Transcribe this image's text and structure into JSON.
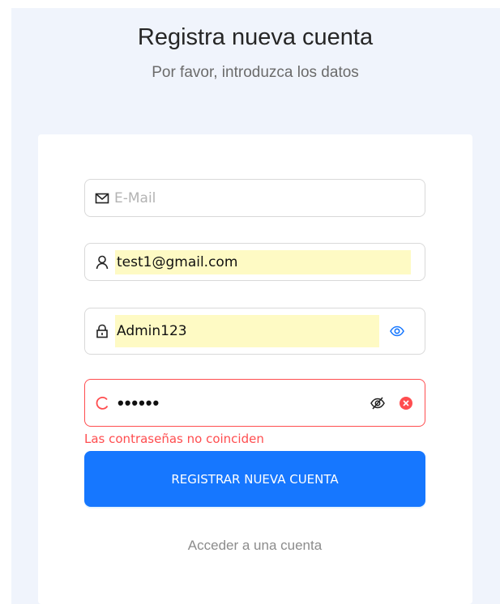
{
  "header": {
    "title": "Registra nueva cuenta",
    "subtitle": "Por favor, introduzca los datos"
  },
  "form": {
    "email": {
      "placeholder": "E-Mail",
      "value": "",
      "icon": "mail-icon"
    },
    "username": {
      "value": "test1@gmail.com",
      "icon": "user-icon"
    },
    "password": {
      "value": "Admin123",
      "icon": "lock-icon",
      "toggle_icon": "eye-icon"
    },
    "confirm_password": {
      "masked_value": "••••••",
      "icon": "loading-icon",
      "toggle_icon": "eye-invisible-icon",
      "clear_icon": "close-circle-icon",
      "error": "Las contraseñas no coinciden"
    },
    "submit_label": "REGISTRAR NUEVA CUENTA",
    "login_link": "Acceder a una cuenta"
  },
  "colors": {
    "primary": "#1677ff",
    "error": "#ff4d4f",
    "autofill": "#fefac4",
    "background": "#f0f4fc"
  }
}
